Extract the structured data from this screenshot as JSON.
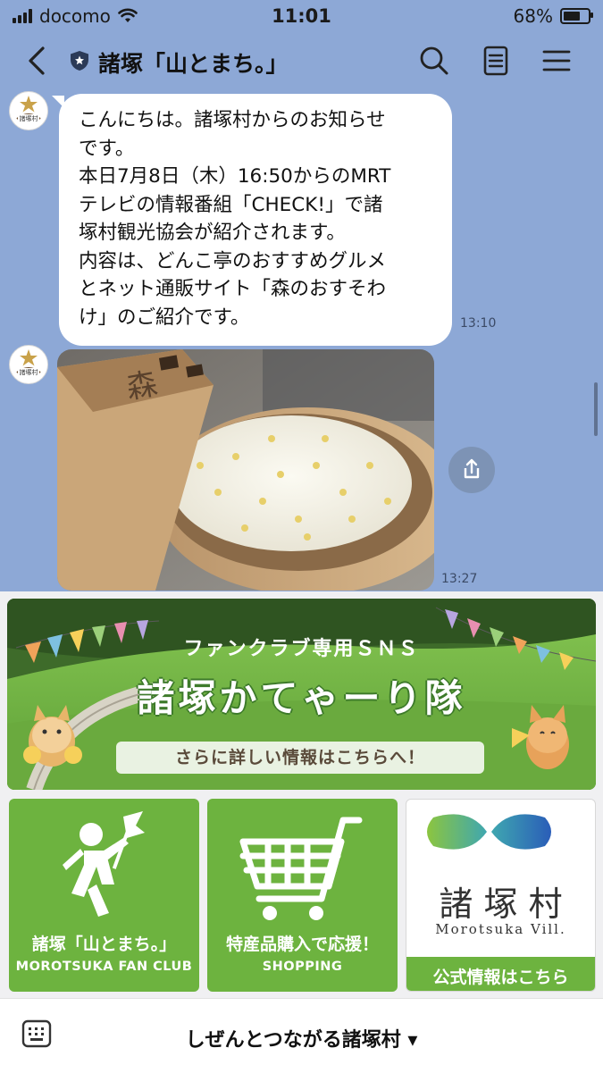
{
  "status": {
    "carrier": "docomo",
    "time": "11:01",
    "battery": "68%",
    "battery_level": 0.68
  },
  "header": {
    "title": "諸塚「山とまち。」"
  },
  "messages": [
    {
      "lines": [
        "こんにちは。諸塚村からのお知らせ",
        "です。",
        "本日7月8日（木）16:50からのMRT",
        "テレビの情報番組「CHECK!」で諸",
        "塚村観光協会が紹介されます。",
        "内容は、どんこ亭のおすすめグルメ",
        "とネット通販サイト「森のおすそわ",
        "け」のご紹介です。"
      ],
      "time": "13:10"
    },
    {
      "type": "image",
      "time": "13:27"
    }
  ],
  "richmenu": {
    "banner": {
      "line1": "ファンクラブ専用ＳＮＳ",
      "line2": "諸塚かてゃーり隊",
      "pill": "さらに詳しい情報はこちらへ！"
    },
    "tiles": [
      {
        "label": "諸塚「山とまち。」",
        "sub": "MOROTSUKA FAN CLUB"
      },
      {
        "label": "特産品購入で応援！",
        "sub": "SHOPPING"
      },
      {
        "village": "諸塚村",
        "roman": "Morotsuka Vill.",
        "label": "公式情報はこちら"
      }
    ]
  },
  "bottom": {
    "menu_label": "しぜんとつながる諸塚村 ▾"
  },
  "colors": {
    "background": "#8da8d6",
    "accent_green": "#6db33f"
  }
}
